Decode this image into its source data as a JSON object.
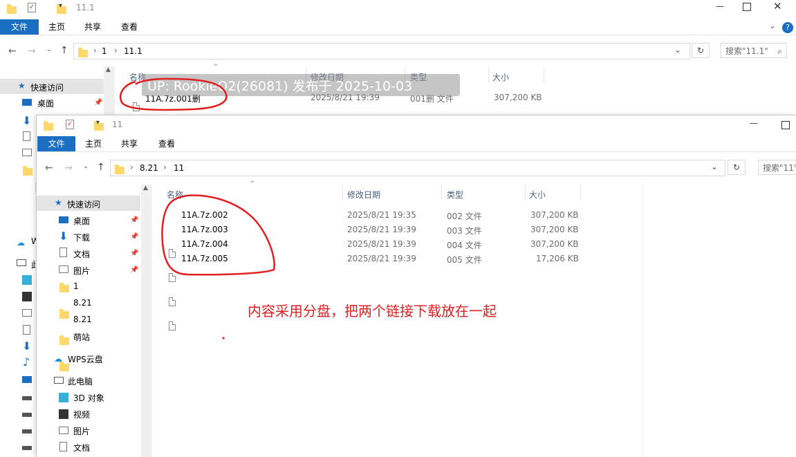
{
  "back_window": {
    "title": "11.1",
    "ribbon": {
      "file": "文件",
      "home": "主页",
      "share": "共享",
      "view": "查看"
    },
    "breadcrumb": [
      "1",
      "11.1"
    ],
    "search_placeholder": "搜索\"11.1\"",
    "columns": {
      "name": "名称",
      "date": "修改日期",
      "type": "类型",
      "size": "大小"
    },
    "quick_access": "快速访问",
    "nav": {
      "desktop": "桌面",
      "wps": "W",
      "pc": "此"
    },
    "file": {
      "name": "11A.7z.001删",
      "date": "2025/8/21 19:39",
      "type": "001删 文件",
      "size": "307,200 KB"
    }
  },
  "watermark": "UP: RookieO2(26081) 发布于 2025-10-03",
  "front_window": {
    "title": "11",
    "ribbon": {
      "file": "文件",
      "home": "主页",
      "share": "共享",
      "view": "查看"
    },
    "breadcrumb": [
      "8.21",
      "11"
    ],
    "search_placeholder": "搜索\"11\"",
    "columns": {
      "name": "名称",
      "date": "修改日期",
      "type": "类型",
      "size": "大小"
    },
    "quick_access": "快速访问",
    "nav_items": [
      {
        "label": "桌面",
        "icon": "desktop-icon",
        "pinned": true
      },
      {
        "label": "下载",
        "icon": "download-icon",
        "pinned": true
      },
      {
        "label": "文档",
        "icon": "document-icon",
        "pinned": true
      },
      {
        "label": "图片",
        "icon": "picture-icon",
        "pinned": true
      },
      {
        "label": "1",
        "icon": "folder-icon",
        "pinned": false
      },
      {
        "label": "8.21",
        "icon": "folder-icon",
        "pinned": false
      },
      {
        "label": "8.21",
        "icon": "folder-icon",
        "pinned": false
      },
      {
        "label": "萌站",
        "icon": "folder-icon",
        "pinned": false
      }
    ],
    "wps_cloud": "WPS云盘",
    "this_pc": "此电脑",
    "pc_items": [
      {
        "label": "3D 对象",
        "icon": "3d-objects-icon"
      },
      {
        "label": "视频",
        "icon": "video-icon"
      },
      {
        "label": "图片",
        "icon": "picture-icon"
      },
      {
        "label": "文档",
        "icon": "document-icon"
      }
    ],
    "files": [
      {
        "name": "11A.7z.002",
        "date": "2025/8/21 19:35",
        "type": "002 文件",
        "size": "307,200 KB"
      },
      {
        "name": "11A.7z.003",
        "date": "2025/8/21 19:39",
        "type": "003 文件",
        "size": "307,200 KB"
      },
      {
        "name": "11A.7z.004",
        "date": "2025/8/21 19:39",
        "type": "004 文件",
        "size": "307,200 KB"
      },
      {
        "name": "11A.7z.005",
        "date": "2025/8/21 19:39",
        "type": "005 文件",
        "size": "17,206 KB"
      }
    ],
    "annotation": "内容采用分盘，把两个链接下载放在一起"
  },
  "colors": {
    "accent": "#1a6fc3",
    "annotation_red": "#e02020",
    "selection": "#cce8ff",
    "folder": "#ffd76b"
  }
}
